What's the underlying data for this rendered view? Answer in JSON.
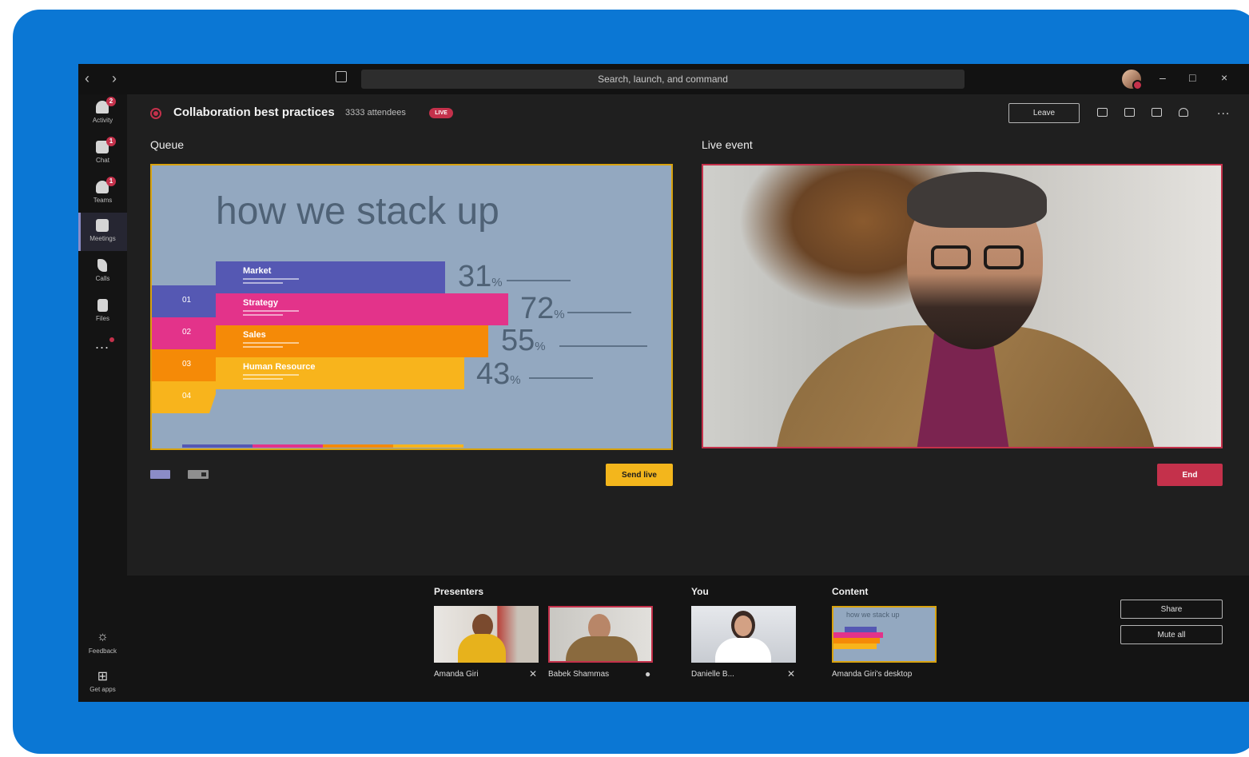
{
  "titlebar": {
    "back_icon": "chevron-left-icon",
    "forward_icon": "chevron-right-icon",
    "search_placeholder": "Search, launch, and command",
    "minimize": "–",
    "maximize": "□",
    "close": "×"
  },
  "rail": {
    "items": [
      {
        "label": "Activity",
        "badge": "2",
        "icon": "bell-icon"
      },
      {
        "label": "Chat",
        "badge": "1",
        "icon": "chat-icon"
      },
      {
        "label": "Teams",
        "badge": "1",
        "icon": "teams-icon"
      },
      {
        "label": "Meetings",
        "badge": "",
        "icon": "calendar-icon"
      },
      {
        "label": "Calls",
        "badge": "",
        "icon": "phone-icon"
      },
      {
        "label": "Files",
        "badge": "",
        "icon": "file-icon"
      }
    ],
    "more": "...",
    "feedback": "Feedback",
    "get_apps": "Get apps"
  },
  "header": {
    "title": "Collaboration best practices",
    "attendees": "3333 attendees",
    "live_badge": "LIVE",
    "leave_label": "Leave",
    "more": "..."
  },
  "queue": {
    "label": "Queue",
    "send_live_label": "Send live",
    "slide": {
      "title": "how we stack up",
      "rows": [
        {
          "step": "01",
          "name": "Market",
          "pct": "31",
          "color": "#5558b3"
        },
        {
          "step": "02",
          "name": "Strategy",
          "pct": "72",
          "color": "#e3338a"
        },
        {
          "step": "03",
          "name": "Sales",
          "pct": "55",
          "color": "#f58a07"
        },
        {
          "step": "04",
          "name": "Human Resource",
          "pct": "43",
          "color": "#f8b41c"
        }
      ],
      "pct_unit": "%"
    }
  },
  "live_event": {
    "label": "Live event",
    "end_label": "End"
  },
  "bottom": {
    "presenters_label": "Presenters",
    "you_label": "You",
    "content_label": "Content",
    "presenters": [
      {
        "name": "Amanda Giri",
        "mic": "muted"
      },
      {
        "name": "Babek Shammas",
        "mic": "on"
      }
    ],
    "you": {
      "name": "Danielle B...",
      "mic": "muted"
    },
    "content": {
      "name": "Amanda Giri's desktop",
      "preview_title": "how we stack up"
    },
    "share_label": "Share",
    "mute_all_label": "Mute all"
  }
}
